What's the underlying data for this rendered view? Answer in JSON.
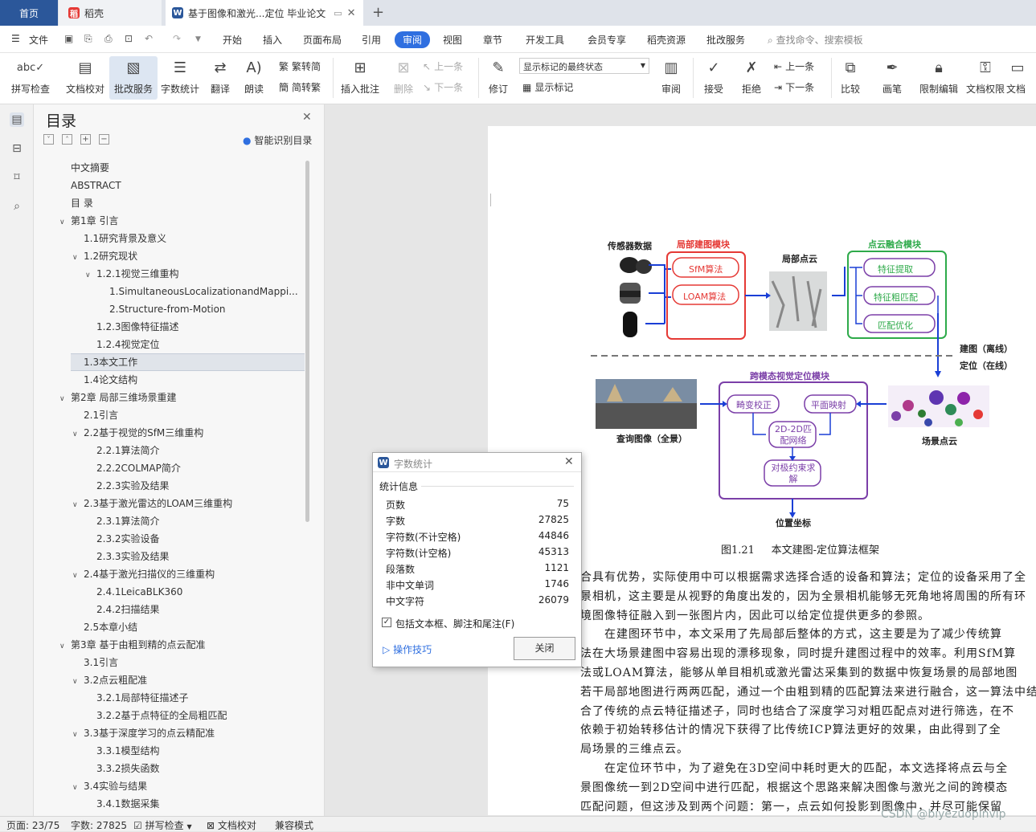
{
  "tabs": {
    "home": "首页",
    "daoke": "稻壳",
    "doc": "基于图像和激光...定位 毕业论文"
  },
  "menu": {
    "file": "文件",
    "items": [
      "开始",
      "插入",
      "页面布局",
      "引用",
      "审阅",
      "视图",
      "章节",
      "开发工具",
      "会员专享",
      "稻壳资源",
      "批改服务"
    ],
    "search": "查找命令、搜索模板"
  },
  "ribbon": {
    "spell": "拼写检查",
    "doc_check": "文档校对",
    "review_service": "批改服务",
    "word_count": "字数统计",
    "translate": "翻译",
    "read": "朗读",
    "trad": "繁转简",
    "simp": "简转繁",
    "insert_comment": "插入批注",
    "delete": "删除",
    "prev": "上一条",
    "next": "下一条",
    "revise": "修订",
    "markup_select": "显示标记的最终状态",
    "show_markup": "显示标记",
    "review": "审阅",
    "accept": "接受",
    "reject": "拒绝",
    "prev2": "上一条",
    "next2": "下一条",
    "compare": "比较",
    "pen": "画笔",
    "restrict": "限制编辑",
    "doc_rights": "文档权限",
    "doc_more": "文档"
  },
  "toc": {
    "title": "目录",
    "smart": "智能识别目录",
    "items": [
      {
        "t": "中文摘要",
        "lvl": 0,
        "arr": ""
      },
      {
        "t": "ABSTRACT",
        "lvl": 0,
        "arr": ""
      },
      {
        "t": "目 录",
        "lvl": 0,
        "arr": ""
      },
      {
        "t": "第1章 引言",
        "lvl": 0,
        "arr": "v"
      },
      {
        "t": "1.1研究背景及意义",
        "lvl": 1,
        "arr": ""
      },
      {
        "t": "1.2研究现状",
        "lvl": 1,
        "arr": "v"
      },
      {
        "t": "1.2.1视觉三维重构",
        "lvl": 2,
        "arr": "v"
      },
      {
        "t": "1.SimultaneousLocalizationandMappi...",
        "lvl": 3,
        "arr": ""
      },
      {
        "t": "2.Structure-from-Motion",
        "lvl": 3,
        "arr": ""
      },
      {
        "t": "1.2.3图像特征描述",
        "lvl": 2,
        "arr": ""
      },
      {
        "t": "1.2.4视觉定位",
        "lvl": 2,
        "arr": ""
      },
      {
        "t": "1.3本文工作",
        "lvl": 1,
        "arr": "",
        "sel": true
      },
      {
        "t": "1.4论文结构",
        "lvl": 1,
        "arr": ""
      },
      {
        "t": "第2章 局部三维场景重建",
        "lvl": 0,
        "arr": "v"
      },
      {
        "t": "2.1引言",
        "lvl": 1,
        "arr": ""
      },
      {
        "t": "2.2基于视觉的SfM三维重构",
        "lvl": 1,
        "arr": "v"
      },
      {
        "t": "2.2.1算法简介",
        "lvl": 2,
        "arr": ""
      },
      {
        "t": "2.2.2COLMAP简介",
        "lvl": 2,
        "arr": ""
      },
      {
        "t": "2.2.3实验及结果",
        "lvl": 2,
        "arr": ""
      },
      {
        "t": "2.3基于激光雷达的LOAM三维重构",
        "lvl": 1,
        "arr": "v"
      },
      {
        "t": "2.3.1算法简介",
        "lvl": 2,
        "arr": ""
      },
      {
        "t": "2.3.2实验设备",
        "lvl": 2,
        "arr": ""
      },
      {
        "t": "2.3.3实验及结果",
        "lvl": 2,
        "arr": ""
      },
      {
        "t": "2.4基于激光扫描仪的三维重构",
        "lvl": 1,
        "arr": "v"
      },
      {
        "t": "2.4.1LeicaBLK360",
        "lvl": 2,
        "arr": ""
      },
      {
        "t": "2.4.2扫描结果",
        "lvl": 2,
        "arr": ""
      },
      {
        "t": "2.5本章小结",
        "lvl": 1,
        "arr": ""
      },
      {
        "t": "第3章 基于由粗到精的点云配准",
        "lvl": 0,
        "arr": "v"
      },
      {
        "t": "3.1引言",
        "lvl": 1,
        "arr": ""
      },
      {
        "t": "3.2点云粗配准",
        "lvl": 1,
        "arr": "v"
      },
      {
        "t": "3.2.1局部特征描述子",
        "lvl": 2,
        "arr": ""
      },
      {
        "t": "3.2.2基于点特征的全局粗匹配",
        "lvl": 2,
        "arr": ""
      },
      {
        "t": "3.3基于深度学习的点云精配准",
        "lvl": 1,
        "arr": "v"
      },
      {
        "t": "3.3.1模型结构",
        "lvl": 2,
        "arr": ""
      },
      {
        "t": "3.3.2损失函数",
        "lvl": 2,
        "arr": ""
      },
      {
        "t": "3.4实验与结果",
        "lvl": 1,
        "arr": "v"
      },
      {
        "t": "3.4.1数据采集",
        "lvl": 2,
        "arr": ""
      }
    ]
  },
  "diagram": {
    "sensor": "传感器数据",
    "local_mod": "局部建图模块",
    "sfm": "SfM算法",
    "loam": "LOAM算法",
    "local_cloud": "局部点云",
    "fusion_mod": "点云融合模块",
    "feat": "特征提取",
    "coarse": "特征粗匹配",
    "refine": "匹配优化",
    "offline": "建图（离线）",
    "online": "定位（在线）",
    "cross_mod": "跨模态视觉定位模块",
    "query": "查询图像（全景）",
    "distort": "畸变校正",
    "plane": "平面映射",
    "match2d": "2D-2D匹配网络",
    "epipolar": "对极约束求解",
    "scene": "场景点云",
    "pose": "位置坐标"
  },
  "caption": "图1.21     本文建图-定位算法框架",
  "body": [
    "合具有优势，实际使用中可以根据需求选择合适的设备和算法；定位的设备采用了全",
    "景相机，这主要是从视野的角度出发的，因为全景相机能够无死角地将周围的所有环",
    "境图像特征融入到一张图片内，因此可以给定位提供更多的参照。",
    "　　在建图环节中，本文采用了先局部后整体的方式，这主要是为了减少传统算",
    "法在大场景建图中容易出现的漂移现象，同时提升建图过程中的效率。利用SfM算",
    "法或LOAM算法，能够从单目相机或激光雷达采集到的数据中恢复场景的局部地图",
    "若干局部地图进行两两匹配，通过一个由粗到精的匹配算法来进行融合，这一算法中结",
    "合了传统的点云特征描述子，同时也结合了深度学习对粗匹配点对进行筛选，在不",
    "依赖于初始转移估计的情况下获得了比传统ICP算法更好的效果，由此得到了全",
    "局场景的三维点云。",
    "　　在定位环节中，为了避免在3D空间中耗时更大的匹配，本文选择将点云与全",
    "景图像统一到2D空间中进行匹配，根据这个思路来解决图像与激光之间的跨模态",
    "匹配问题，但这涉及到两个问题：第一，点云如何投影到图像中，并尽可能保留"
  ],
  "dialog": {
    "title": "字数统计",
    "section": "统计信息",
    "rows": [
      {
        "k": "页数",
        "v": "75"
      },
      {
        "k": "字数",
        "v": "27825"
      },
      {
        "k": "字符数(不计空格)",
        "v": "44846"
      },
      {
        "k": "字符数(计空格)",
        "v": "45313"
      },
      {
        "k": "段落数",
        "v": "1121"
      },
      {
        "k": "非中文单词",
        "v": "1746"
      },
      {
        "k": "中文字符",
        "v": "26079"
      }
    ],
    "include": "包括文本框、脚注和尾注(F)",
    "tips": "操作技巧",
    "close": "关闭"
  },
  "status": {
    "page": "页面: 23/75",
    "words": "字数: 27825",
    "spell": "拼写检查",
    "proof": "文档校对",
    "compat": "兼容模式",
    "watermark": "CSDN @biyezuopinvip"
  },
  "colors": {
    "accent": "#2f6fe0",
    "red": "#e53935",
    "green": "#2eaa4a",
    "purple": "#7b3fa8"
  }
}
